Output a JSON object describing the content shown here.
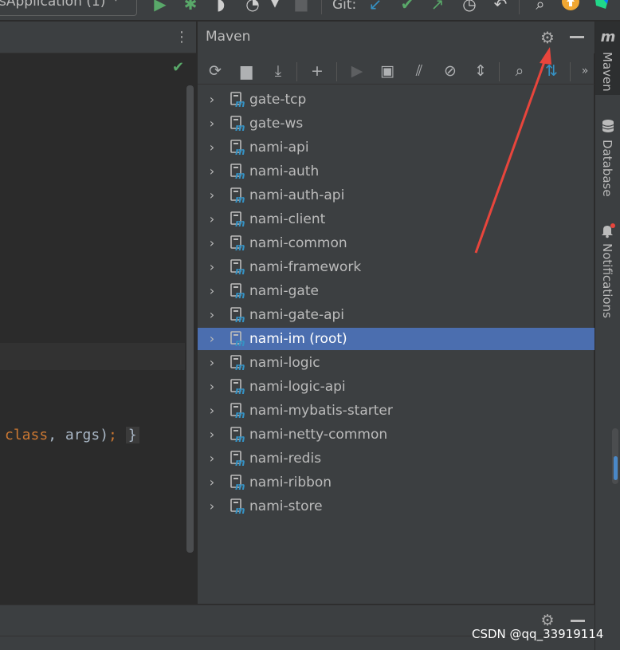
{
  "toolbar": {
    "run_config": "sApplication (1)",
    "git_label": "Git:"
  },
  "editor": {
    "code": {
      "keyword": "class",
      "rest": ", args)",
      "semicolon": ";",
      "brace": "}"
    }
  },
  "maven": {
    "title": "Maven",
    "modules": [
      {
        "label": "gate-tcp",
        "selected": false
      },
      {
        "label": "gate-ws",
        "selected": false
      },
      {
        "label": "nami-api",
        "selected": false
      },
      {
        "label": "nami-auth",
        "selected": false
      },
      {
        "label": "nami-auth-api",
        "selected": false
      },
      {
        "label": "nami-client",
        "selected": false
      },
      {
        "label": "nami-common",
        "selected": false
      },
      {
        "label": "nami-framework",
        "selected": false
      },
      {
        "label": "nami-gate",
        "selected": false
      },
      {
        "label": "nami-gate-api",
        "selected": false
      },
      {
        "label": "nami-im (root)",
        "selected": true
      },
      {
        "label": "nami-logic",
        "selected": false
      },
      {
        "label": "nami-logic-api",
        "selected": false
      },
      {
        "label": "nami-mybatis-starter",
        "selected": false
      },
      {
        "label": "nami-netty-common",
        "selected": false
      },
      {
        "label": "nami-redis",
        "selected": false
      },
      {
        "label": "nami-ribbon",
        "selected": false
      },
      {
        "label": "nami-store",
        "selected": false
      }
    ]
  },
  "stripe": {
    "maven_icon": "m",
    "maven": "Maven",
    "database": "Database",
    "notifications": "Notifications"
  },
  "watermark": "CSDN @qq_33919114",
  "colors": {
    "selection": "#4b6eaf",
    "annotation_arrow": "#e8453c",
    "run_green": "#59a869",
    "git_blue": "#3592c4",
    "update_orange": "#f0a732"
  }
}
